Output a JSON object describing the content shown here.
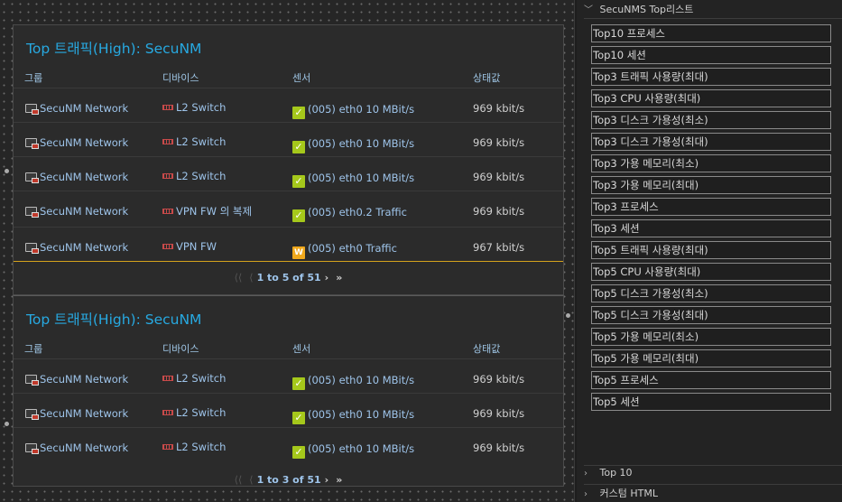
{
  "widgets": [
    {
      "title": "Top 트래픽(High): SecuNM",
      "columns": [
        "그룹",
        "디바이스",
        "센서",
        "상태값"
      ],
      "rows": [
        {
          "group": "SecuNM Network",
          "device": "L2 Switch",
          "sensor": "(005) eth0 10 MBit/s",
          "value": "969 kbit/s",
          "status": "ok"
        },
        {
          "group": "SecuNM Network",
          "device": "L2 Switch",
          "sensor": "(005) eth0 10 MBit/s",
          "value": "969 kbit/s",
          "status": "ok"
        },
        {
          "group": "SecuNM Network",
          "device": "L2 Switch",
          "sensor": "(005) eth0 10 MBit/s",
          "value": "969 kbit/s",
          "status": "ok"
        },
        {
          "group": "SecuNM Network",
          "device": "VPN FW 의 복제",
          "sensor": "(005) eth0.2 Traffic",
          "value": "969 kbit/s",
          "status": "ok"
        },
        {
          "group": "SecuNM Network",
          "device": "VPN FW",
          "sensor": "(005) eth0 Traffic",
          "value": "967 kbit/s",
          "status": "warn"
        }
      ],
      "pager": "1 to 5 of 51"
    },
    {
      "title": "Top 트래픽(High): SecuNM",
      "columns": [
        "그룹",
        "디바이스",
        "센서",
        "상태값"
      ],
      "rows": [
        {
          "group": "SecuNM Network",
          "device": "L2 Switch",
          "sensor": "(005) eth0 10 MBit/s",
          "value": "969 kbit/s",
          "status": "ok"
        },
        {
          "group": "SecuNM Network",
          "device": "L2 Switch",
          "sensor": "(005) eth0 10 MBit/s",
          "value": "969 kbit/s",
          "status": "ok"
        },
        {
          "group": "SecuNM Network",
          "device": "L2 Switch",
          "sensor": "(005) eth0 10 MBit/s",
          "value": "969 kbit/s",
          "status": "ok"
        }
      ],
      "pager": "1 to 3 of 51"
    }
  ],
  "status_icons": {
    "ok": "✓",
    "warn": "W"
  },
  "colors": {
    "title": "#27a9e1",
    "ok": "#a5c81b",
    "warn": "#f0a81c",
    "highlight_line": "#d4a21c"
  },
  "panel": {
    "main_header": "SecuNMS Top리스트",
    "items": [
      "Top10 프로세스",
      "Top10 세션",
      "Top3 트래픽 사용량(최대)",
      "Top3 CPU 사용량(최대)",
      "Top3 디스크 가용성(최소)",
      "Top3 디스크 가용성(최대)",
      "Top3 가용 메모리(최소)",
      "Top3 가용 메모리(최대)",
      "Top3 프로세스",
      "Top3 세션",
      "Top5 트래픽 사용량(최대)",
      "Top5 CPU 사용량(최대)",
      "Top5 디스크 가용성(최소)",
      "Top5 디스크 가용성(최대)",
      "Top5 가용 메모리(최소)",
      "Top5 가용 메모리(최대)",
      "Top5 프로세스",
      "Top5 세션"
    ],
    "top10_header": "Top 10",
    "custom_header": "커스텀 HTML"
  }
}
